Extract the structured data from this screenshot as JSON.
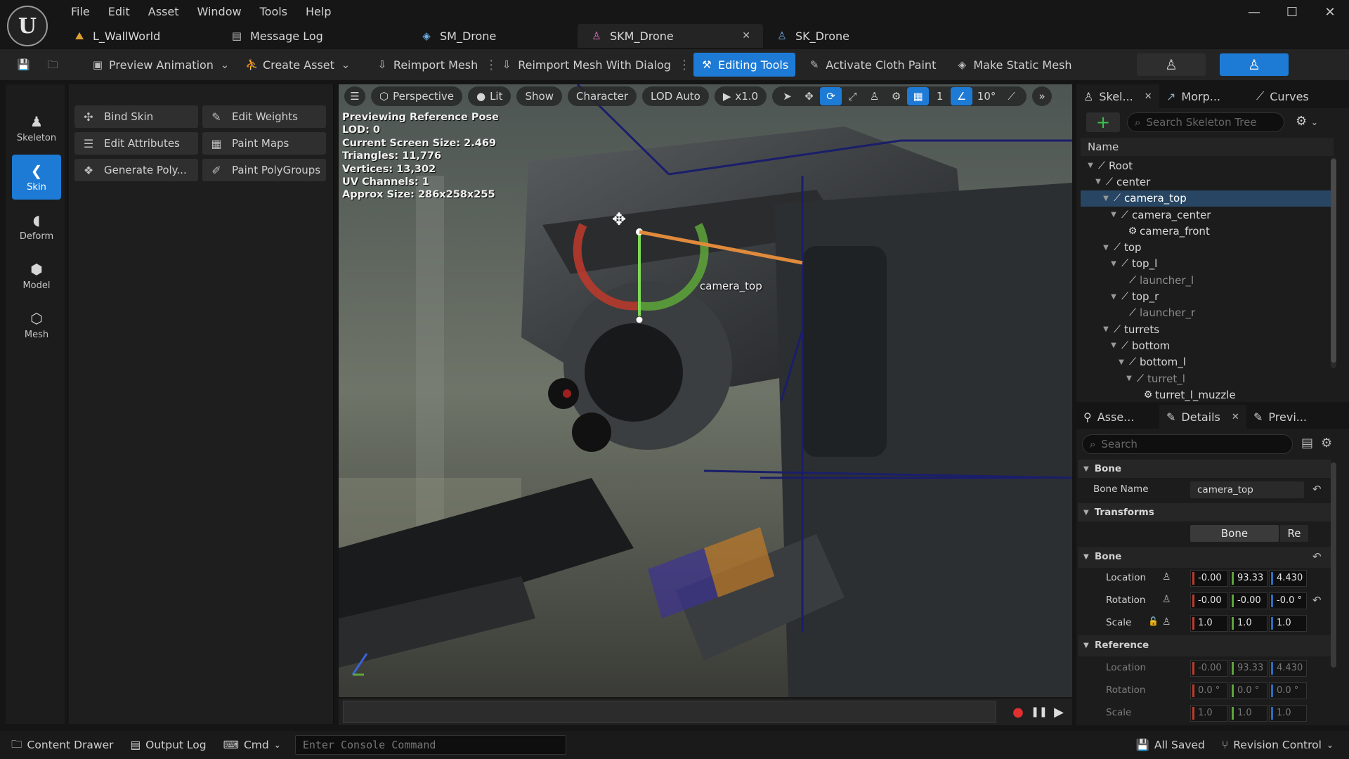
{
  "app": {
    "logo": "U",
    "menu": [
      "File",
      "Edit",
      "Asset",
      "Window",
      "Tools",
      "Help"
    ],
    "window_controls": {
      "minimize": "—",
      "maximize": "☐",
      "close": "✕"
    }
  },
  "doc_tabs": [
    {
      "label": "L_WallWorld",
      "icon": "level-icon",
      "glyph": "⛰"
    },
    {
      "label": "Message Log",
      "icon": "log-icon",
      "glyph": "▤"
    },
    {
      "label": "SM_Drone",
      "icon": "static-mesh-icon",
      "glyph": "◈"
    },
    {
      "label": "SKM_Drone",
      "icon": "skeletal-mesh-icon",
      "glyph": "♙",
      "active": true,
      "close": "✕"
    },
    {
      "label": "SK_Drone",
      "icon": "skeleton-icon",
      "glyph": "♙"
    }
  ],
  "toolbar": {
    "save_glyph": "💾",
    "browse_glyph": "🗀",
    "preview_animation": "Preview Animation",
    "create_asset": "Create Asset",
    "reimport_mesh": "Reimport Mesh",
    "reimport_mesh_with_dialog": "Reimport Mesh With Dialog",
    "editing_tools": "Editing Tools",
    "activate_cloth_paint": "Activate Cloth Paint",
    "make_static_mesh": "Make Static Mesh",
    "more_glyph": "⋮",
    "accent": "#1d7bd6"
  },
  "modes": [
    {
      "label": "Skeleton",
      "glyph": "♟",
      "icon": "skeleton-mode-icon"
    },
    {
      "label": "Skin",
      "glyph": "❮",
      "icon": "skin-mode-icon",
      "active": true
    },
    {
      "label": "Deform",
      "glyph": "◖",
      "icon": "deform-mode-icon"
    },
    {
      "label": "Model",
      "glyph": "⬢",
      "icon": "model-mode-icon"
    },
    {
      "label": "Mesh",
      "glyph": "⬡",
      "icon": "mesh-mode-icon"
    }
  ],
  "tools": [
    {
      "label": "Bind Skin",
      "glyph": "✣",
      "icon": "bind-skin-icon"
    },
    {
      "label": "Edit Weights",
      "glyph": "✎",
      "icon": "edit-weights-icon"
    },
    {
      "label": "Edit Attributes",
      "glyph": "☰",
      "icon": "edit-attributes-icon"
    },
    {
      "label": "Paint Maps",
      "glyph": "▦",
      "icon": "paint-maps-icon"
    },
    {
      "label": "Generate Poly...",
      "glyph": "❖",
      "icon": "generate-poly-icon"
    },
    {
      "label": "Paint PolyGroups",
      "glyph": "✐",
      "icon": "paint-polygroups-icon"
    }
  ],
  "viewport": {
    "menu_glyph": "☰",
    "perspective": "Perspective",
    "lit": "Lit",
    "show": "Show",
    "character": "Character",
    "lod": "LOD Auto",
    "speed": "x1.0",
    "grid_value": "1",
    "angle_value": "10°",
    "overflow_glyph": "»",
    "stats": [
      "Previewing Reference Pose",
      "LOD: 0",
      "Current Screen Size: 2.469",
      "Triangles: 11,776",
      "Vertices: 13,302",
      "UV Channels: 1",
      "Approx Size: 286x258x255"
    ],
    "selected_bone_label": "camera_top",
    "gizmo_colors": {
      "x": "#c0392b",
      "y": "#5ea63a",
      "bone": "#e08a3c"
    }
  },
  "timeline": {
    "record": "●",
    "pause": "❚❚",
    "play": "▶"
  },
  "skeleton_panel": {
    "tabs": [
      {
        "label": "Skel...",
        "close": "✕",
        "icon": "skeleton-tree-icon",
        "glyph": "♙",
        "active": true
      },
      {
        "label": "Morp...",
        "icon": "morph-icon",
        "glyph": "↗"
      },
      {
        "label": "Curves",
        "icon": "curves-icon",
        "glyph": "⟋"
      }
    ],
    "add_glyph": "+",
    "search_placeholder": "Search Skeleton Tree",
    "settings_glyph": "⚙",
    "column_name": "Name",
    "bones": [
      {
        "name": "Root",
        "depth": 0,
        "arrow": "▼"
      },
      {
        "name": "center",
        "depth": 1,
        "arrow": "▼"
      },
      {
        "name": "camera_top",
        "depth": 2,
        "arrow": "▼",
        "selected": true
      },
      {
        "name": "camera_center",
        "depth": 3,
        "arrow": "▼"
      },
      {
        "name": "camera_front",
        "depth": 4,
        "arrow": "",
        "socket": true
      },
      {
        "name": "top",
        "depth": 2,
        "arrow": "▼"
      },
      {
        "name": "top_l",
        "depth": 3,
        "arrow": "▼"
      },
      {
        "name": "launcher_l",
        "depth": 4,
        "arrow": "",
        "dim": true
      },
      {
        "name": "top_r",
        "depth": 3,
        "arrow": "▼"
      },
      {
        "name": "launcher_r",
        "depth": 4,
        "arrow": "",
        "dim": true
      },
      {
        "name": "turrets",
        "depth": 2,
        "arrow": "▼"
      },
      {
        "name": "bottom",
        "depth": 3,
        "arrow": "▼"
      },
      {
        "name": "bottom_l",
        "depth": 4,
        "arrow": "▼"
      },
      {
        "name": "turret_l",
        "depth": 5,
        "arrow": "▼",
        "dim": true
      },
      {
        "name": "turret_l_muzzle",
        "depth": 6,
        "arrow": "",
        "socket": true
      }
    ]
  },
  "details_panel": {
    "tabs": [
      {
        "label": "Asse...",
        "icon": "asset-details-icon",
        "glyph": "⚲"
      },
      {
        "label": "Details",
        "close": "✕",
        "icon": "details-icon",
        "glyph": "✎",
        "active": true
      },
      {
        "label": "Previ...",
        "icon": "preview-settings-icon",
        "glyph": "✎"
      }
    ],
    "search_placeholder": "Search",
    "bone_section": "Bone",
    "bone_name_label": "Bone Name",
    "bone_name_value": "camera_top",
    "transforms_section": "Transforms",
    "seg_bone": "Bone",
    "seg_reference": "Re",
    "bone_sub": "Bone",
    "location_label": "Location",
    "rotation_label": "Rotation",
    "scale_label": "Scale",
    "bone_location": [
      "-0.00",
      "93.33",
      "4.430"
    ],
    "bone_rotation": [
      "-0.00",
      "-0.00",
      "-0.0 °"
    ],
    "bone_scale": [
      "1.0",
      "1.0",
      "1.0"
    ],
    "reference_sub": "Reference",
    "ref_location": [
      "-0.00",
      "93.33",
      "4.430"
    ],
    "ref_rotation": [
      "0.0 °",
      "0.0 °",
      "0.0 °"
    ],
    "ref_scale": [
      "1.0",
      "1.0",
      "1.0"
    ],
    "reset_glyph": "↶",
    "gizmo_glyph": "♙",
    "lock_glyph": "🔓"
  },
  "statusbar": {
    "content_drawer": "Content Drawer",
    "output_log": "Output Log",
    "cmd": "Cmd",
    "console_placeholder": "Enter Console Command",
    "all_saved": "All Saved",
    "revision_control": "Revision Control"
  }
}
